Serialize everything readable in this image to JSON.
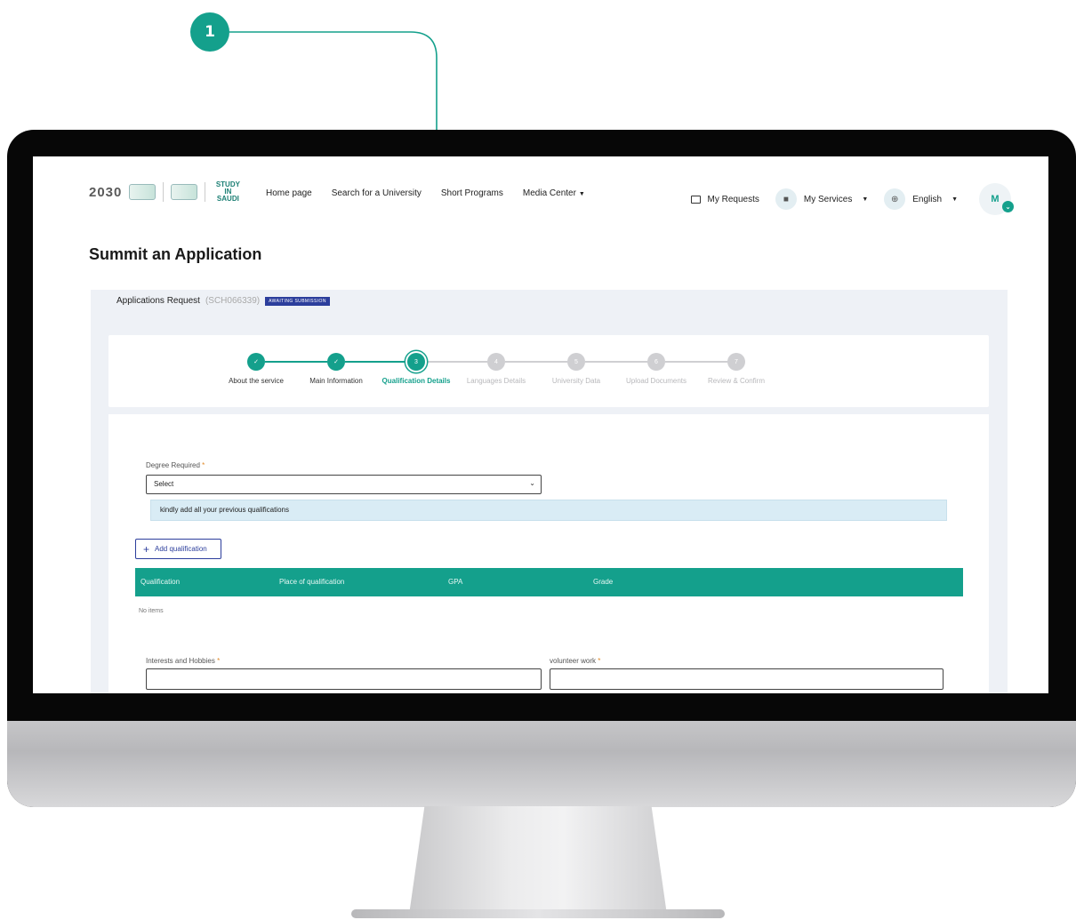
{
  "callout": {
    "number": "1"
  },
  "header": {
    "logo_2030": "2030",
    "logo_study": "STUDY IN SAUDI",
    "nav": [
      "Home page",
      "Search for a University",
      "Short Programs",
      "Media Center"
    ],
    "my_requests": "My Requests",
    "my_services": "My Services",
    "language": "English",
    "avatar_initial": "M"
  },
  "page": {
    "title": "Summit an Application"
  },
  "request": {
    "label": "Applications Request",
    "code": "(SCH066339)",
    "status": "AWAITING SUBMISSION"
  },
  "steps": [
    {
      "num": "✓",
      "label": "About the service",
      "state": "done"
    },
    {
      "num": "✓",
      "label": "Main Information",
      "state": "done"
    },
    {
      "num": "3",
      "label": "Qualification Details",
      "state": "active"
    },
    {
      "num": "4",
      "label": "Languages Details",
      "state": "todo"
    },
    {
      "num": "5",
      "label": "University Data",
      "state": "todo"
    },
    {
      "num": "6",
      "label": "Upload Documents",
      "state": "todo"
    },
    {
      "num": "7",
      "label": "Review & Confirm",
      "state": "todo"
    }
  ],
  "form": {
    "degree_label": "Degree Required",
    "degree_value": "Select",
    "info_text": "kindly add all your previous qualifications",
    "add_button": "Add qualification",
    "table_headers": [
      "Qualification",
      "Place of qualification",
      "GPA",
      "Grade"
    ],
    "no_items": "No items",
    "interests_label": "Interests and Hobbies",
    "volunteer_label": "volunteer work",
    "required_mark": "*"
  },
  "colors": {
    "accent": "#14a08c",
    "status_badge": "#2c3e9c",
    "step_todo": "#cfcfd2"
  }
}
